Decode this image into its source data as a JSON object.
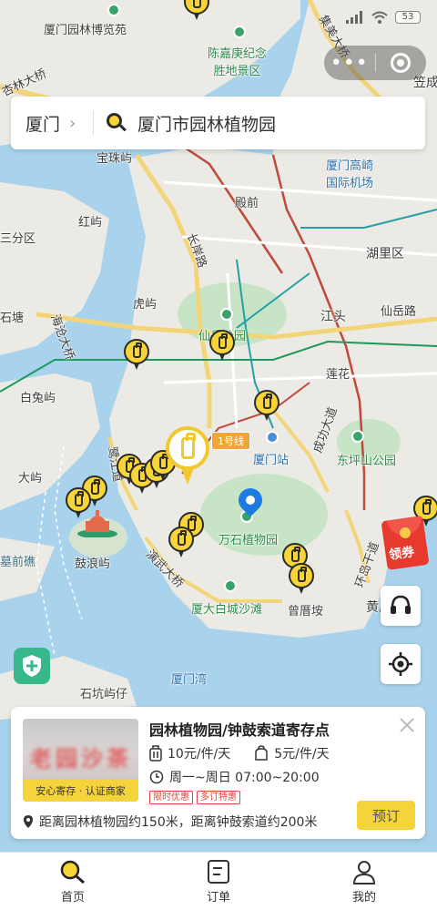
{
  "status_bar": {
    "battery": "53"
  },
  "capsule": {
    "more_icon": "more-dots-icon",
    "close_icon": "target-circle-icon"
  },
  "search": {
    "city": "厦门",
    "query": "厦门市园林植物园"
  },
  "map": {
    "labels": {
      "garden_expo": "厦门园林博览苑",
      "chen_jiageng": "陈嘉庚纪念\n胜地景区",
      "jimei_bridge": "集美大桥",
      "xinglin_bridge": "杏林大桥",
      "baozhu": "宝珠屿",
      "airport": "厦门高崎\n国际机场",
      "dianqian": "殿前",
      "hongyu": "红屿",
      "sanfenqu": "三分区",
      "changan": "长岸路",
      "hulixi": "湖里区",
      "huyu": "虎屿",
      "xianyue_park": "仙岳公园",
      "jiangtou": "江头",
      "xianyue_rd": "仙岳路",
      "shitang": "石塘",
      "haicang_bridge": "海沧大桥",
      "lianhua": "莲花",
      "baituyu": "白兔屿",
      "chenggong": "成功大道",
      "metro_line": "1号线",
      "xiamen_station": "厦门站",
      "dongping_park": "东坪山公园",
      "dayu": "大屿",
      "lujiang": "鹭江道",
      "wanshi": "万石植物园",
      "gulangyu": "鼓浪屿",
      "yuqian": "墓前礁",
      "yandahu": "演武大桥",
      "huandao": "环岛干道",
      "xiada": "厦大白城沙滩",
      "zengcuoan": "曾厝垵",
      "xiamen_bay": "厦门湾",
      "shikeng": "石坑屿仔",
      "licheng": "笠成",
      "huangcuo": "黄厝"
    }
  },
  "coupon": {
    "label": "领券"
  },
  "card": {
    "title": "园林植物园/钟鼓索道寄存点",
    "thumb_text": "老园沙茶",
    "badge": "安心寄存 · 认证商家",
    "price_large": "10元/件/天",
    "price_small": "5元/件/天",
    "hours": "周一~周日 07:00~20:00",
    "tags": [
      "限时优惠",
      "多订特惠"
    ],
    "distance": "距离园林植物园约150米，距离钟鼓索道约200米",
    "book_label": "预订"
  },
  "tabs": [
    {
      "label": "首页",
      "icon": "search-icon"
    },
    {
      "label": "订单",
      "icon": "order-icon"
    },
    {
      "label": "我的",
      "icon": "profile-icon"
    }
  ],
  "colors": {
    "accent": "#f5d33a",
    "route_red": "#c0493a",
    "metro_green": "#1c9a5c",
    "metro_teal": "#22a0a6",
    "water": "#a9d3ec",
    "land": "#eceae4",
    "park": "#c7e5c6"
  }
}
